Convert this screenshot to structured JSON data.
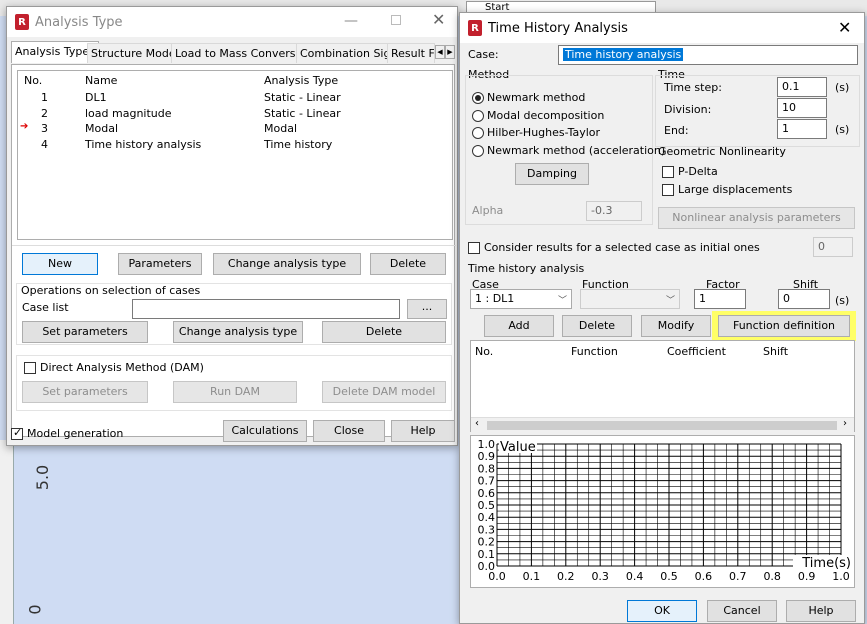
{
  "background": {
    "toolbar_combo": "Start",
    "scale_labels": [
      "5.0",
      "0"
    ]
  },
  "analysis_window": {
    "title": "Analysis Type",
    "tabs": [
      "Analysis Types",
      "Structure Model",
      "Load to Mass Conversion",
      "Combination Sign",
      "Result Fi"
    ],
    "columns": [
      "No.",
      "Name",
      "Analysis Type"
    ],
    "rows": [
      {
        "no": "1",
        "name": "DL1",
        "type": "Static - Linear",
        "current": false
      },
      {
        "no": "2",
        "name": "load magnitude",
        "type": "Static - Linear",
        "current": false
      },
      {
        "no": "3",
        "name": "Modal",
        "type": "Modal",
        "current": true
      },
      {
        "no": "4",
        "name": "Time history analysis",
        "type": "Time history",
        "current": false
      }
    ],
    "buttons": {
      "new": "New",
      "parameters": "Parameters",
      "change_type": "Change analysis type",
      "delete": "Delete"
    },
    "selection_group": "Operations on selection of cases",
    "case_list_label": "Case list",
    "case_list_value": "",
    "browse": "...",
    "sel_buttons": {
      "set_params": "Set parameters",
      "change_type": "Change analysis type",
      "delete": "Delete"
    },
    "dam_label": "Direct Analysis Method (DAM)",
    "dam_buttons": {
      "set_params": "Set parameters",
      "run": "Run DAM",
      "delete": "Delete DAM model"
    },
    "model_generation": "Model generation",
    "bottom_buttons": {
      "calculations": "Calculations",
      "close": "Close",
      "help": "Help"
    }
  },
  "th_window": {
    "title": "Time History Analysis",
    "case_label": "Case:",
    "case_value": "Time history analysis",
    "method_label": "Method",
    "methods": [
      {
        "label": "Newmark method",
        "selected": true
      },
      {
        "label": "Modal decomposition",
        "selected": false
      },
      {
        "label": "Hilber-Hughes-Taylor",
        "selected": false
      },
      {
        "label": "Newmark method (acceleration)",
        "selected": false
      }
    ],
    "damping": "Damping",
    "alpha_label": "Alpha",
    "alpha_value": "-0.3",
    "time_label": "Time",
    "time_step_label": "Time step:",
    "time_step_value": "0.1",
    "division_label": "Division:",
    "division_value": "10",
    "end_label": "End:",
    "end_value": "1",
    "unit_s": "(s)",
    "geo_label": "Geometric Nonlinearity",
    "pdelta": "P-Delta",
    "large_disp": "Large displacements",
    "nonlinear_params": "Nonlinear analysis parameters",
    "consider_results": "Consider results for a selected case as initial ones",
    "consider_value": "0",
    "tha_label": "Time history analysis",
    "col_case": "Case",
    "col_function": "Function",
    "col_factor": "Factor",
    "col_shift": "Shift",
    "case_combo": "1 : DL1",
    "function_combo": "",
    "factor_value": "1",
    "shift_value": "0",
    "btn_add": "Add",
    "btn_delete": "Delete",
    "btn_modify": "Modify",
    "btn_function_def": "Function definition",
    "list_headers": [
      "No.",
      "Function",
      "Coefficient",
      "Shift"
    ],
    "ok": "OK",
    "cancel": "Cancel",
    "help": "Help",
    "highlight_color": "#ffff66"
  },
  "chart_data": {
    "type": "line",
    "title": "",
    "ylabel": "Value",
    "xlabel": "Time(s)",
    "xlim": [
      0,
      1
    ],
    "ylim": [
      0,
      1
    ],
    "x_ticks": [
      "0.0",
      "0.1",
      "0.2",
      "0.3",
      "0.4",
      "0.5",
      "0.6",
      "0.7",
      "0.8",
      "0.9",
      "1.0"
    ],
    "y_ticks": [
      "0.0",
      "0.1",
      "0.2",
      "0.3",
      "0.4",
      "0.5",
      "0.6",
      "0.7",
      "0.8",
      "0.9",
      "1.0"
    ],
    "series": [],
    "grid": true
  }
}
